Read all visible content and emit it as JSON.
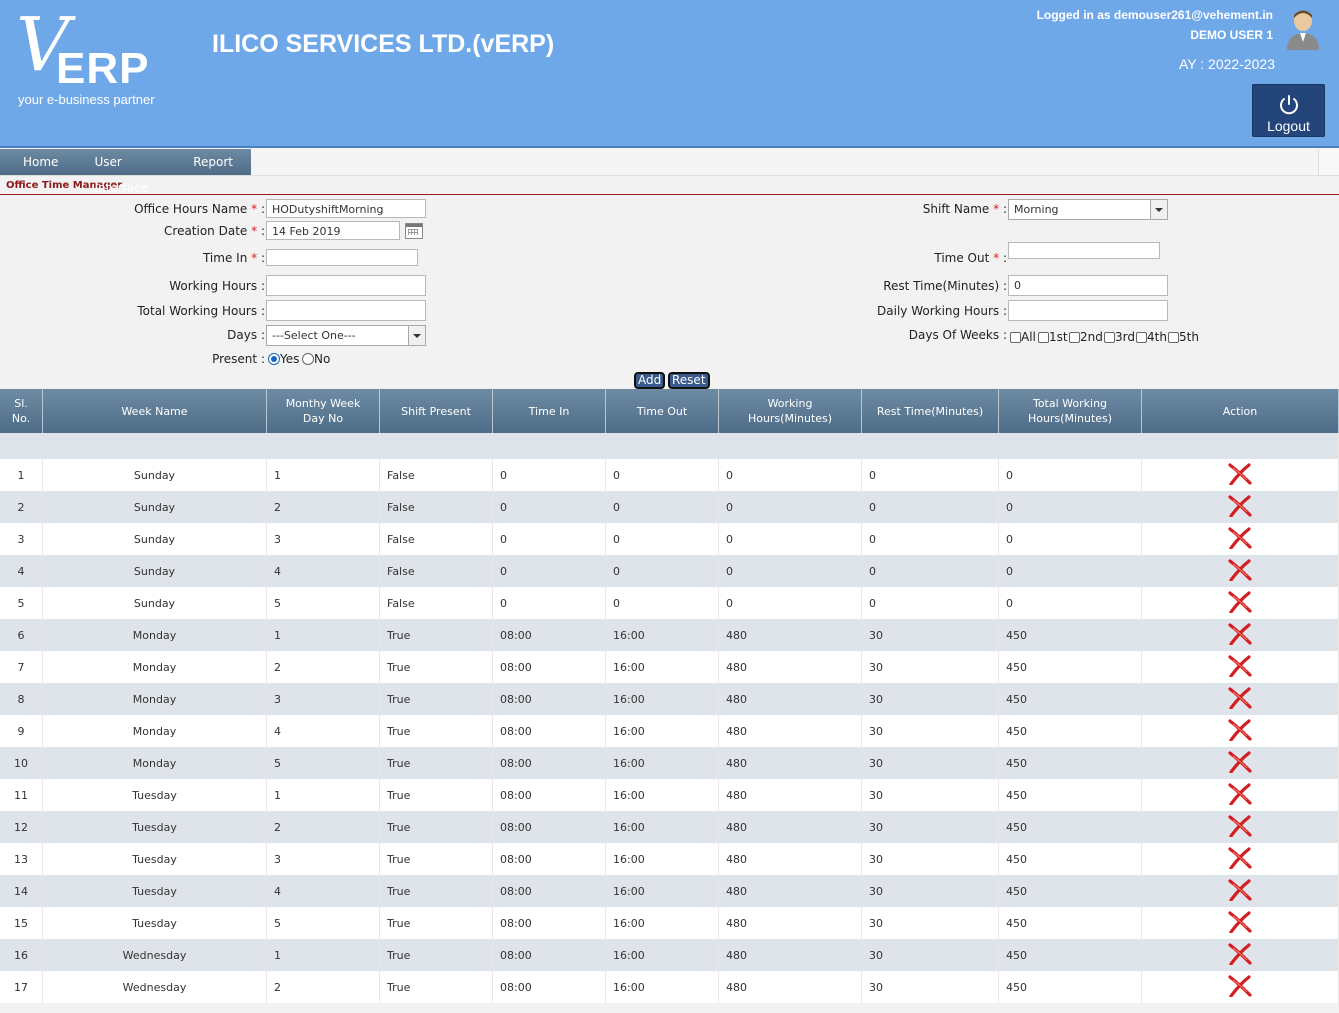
{
  "header": {
    "logo_mark": "V",
    "logo_text": "ERP",
    "tagline": "your e-business partner",
    "company": "ILICO SERVICES LTD.(vERP)",
    "logged_in": "Logged in as demouser261@vehement.in",
    "user": "DEMO USER 1",
    "ay": "AY : 2022-2023",
    "logout": "Logout"
  },
  "nav": {
    "home": "Home",
    "ui": "User Interface",
    "report": "Report"
  },
  "section_title": "Office Time Manager",
  "form": {
    "office_hours_name_label": "Office Hours Name",
    "office_hours_name_value": "HODutyshiftMorning",
    "creation_date_label": "Creation Date",
    "creation_date_value": "14 Feb 2019",
    "time_in_label": "Time In",
    "working_hours_label": "Working Hours",
    "total_working_hours_label": "Total Working Hours",
    "days_label": "Days",
    "days_value": "---Select One---",
    "present_label": "Present",
    "present_yes": "Yes",
    "present_no": "No",
    "shift_name_label": "Shift Name",
    "shift_name_value": "Morning",
    "time_out_label": "Time Out",
    "rest_time_label": "Rest Time(Minutes)",
    "rest_time_value": "0",
    "daily_working_hours_label": "Daily Working Hours",
    "days_of_weeks_label": "Days Of Weeks",
    "dow_all": "All",
    "dow_1": "1st",
    "dow_2": "2nd",
    "dow_3": "3rd",
    "dow_4": "4th",
    "dow_5": "5th",
    "colon": ":",
    "req": "*",
    "add": "Add",
    "reset": "Reset"
  },
  "table": {
    "headers": [
      "Sl.\nNo.",
      "Week Name",
      "Monthy Week\nDay No",
      "Shift Present",
      "Time In",
      "Time Out",
      "Working\nHours(Minutes)",
      "Rest Time(Minutes)",
      "Total Working\nHours(Minutes)",
      "Action"
    ],
    "rows": [
      [
        "1",
        "Sunday",
        "1",
        "False",
        "0",
        "0",
        "0",
        "0",
        "0"
      ],
      [
        "2",
        "Sunday",
        "2",
        "False",
        "0",
        "0",
        "0",
        "0",
        "0"
      ],
      [
        "3",
        "Sunday",
        "3",
        "False",
        "0",
        "0",
        "0",
        "0",
        "0"
      ],
      [
        "4",
        "Sunday",
        "4",
        "False",
        "0",
        "0",
        "0",
        "0",
        "0"
      ],
      [
        "5",
        "Sunday",
        "5",
        "False",
        "0",
        "0",
        "0",
        "0",
        "0"
      ],
      [
        "6",
        "Monday",
        "1",
        "True",
        "08:00",
        "16:00",
        "480",
        "30",
        "450"
      ],
      [
        "7",
        "Monday",
        "2",
        "True",
        "08:00",
        "16:00",
        "480",
        "30",
        "450"
      ],
      [
        "8",
        "Monday",
        "3",
        "True",
        "08:00",
        "16:00",
        "480",
        "30",
        "450"
      ],
      [
        "9",
        "Monday",
        "4",
        "True",
        "08:00",
        "16:00",
        "480",
        "30",
        "450"
      ],
      [
        "10",
        "Monday",
        "5",
        "True",
        "08:00",
        "16:00",
        "480",
        "30",
        "450"
      ],
      [
        "11",
        "Tuesday",
        "1",
        "True",
        "08:00",
        "16:00",
        "480",
        "30",
        "450"
      ],
      [
        "12",
        "Tuesday",
        "2",
        "True",
        "08:00",
        "16:00",
        "480",
        "30",
        "450"
      ],
      [
        "13",
        "Tuesday",
        "3",
        "True",
        "08:00",
        "16:00",
        "480",
        "30",
        "450"
      ],
      [
        "14",
        "Tuesday",
        "4",
        "True",
        "08:00",
        "16:00",
        "480",
        "30",
        "450"
      ],
      [
        "15",
        "Tuesday",
        "5",
        "True",
        "08:00",
        "16:00",
        "480",
        "30",
        "450"
      ],
      [
        "16",
        "Wednesday",
        "1",
        "True",
        "08:00",
        "16:00",
        "480",
        "30",
        "450"
      ],
      [
        "17",
        "Wednesday",
        "2",
        "True",
        "08:00",
        "16:00",
        "480",
        "30",
        "450"
      ]
    ]
  },
  "colors": {
    "header_bg": "#6fa8e8",
    "nav_bg": "#4f6d88",
    "delete_icon": "#d21f1f"
  },
  "icons": {
    "delete": "delete-x-icon",
    "logout": "power-icon",
    "avatar": "user-avatar-icon",
    "calendar": "calendar-icon"
  }
}
